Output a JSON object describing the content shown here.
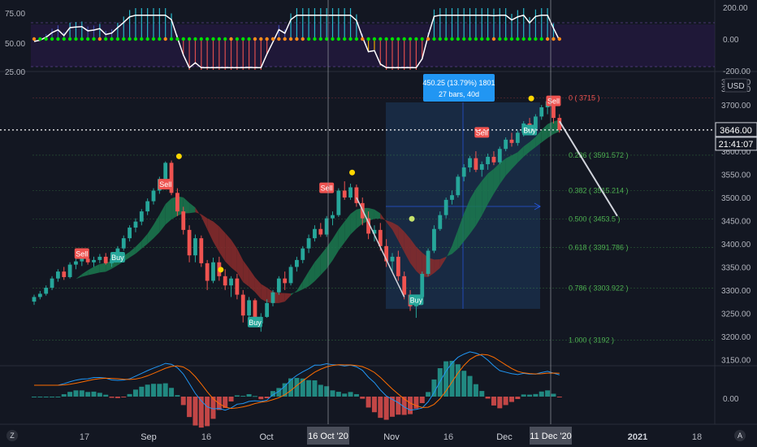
{
  "chart_data": [
    {
      "type": "line",
      "panel": "oscillator",
      "left_axis_ticks": [
        "75.00",
        "50.00",
        "25.00"
      ],
      "right_axis_ticks": [
        "200.00",
        "0.00",
        "-200.00"
      ],
      "colors": {
        "line": "#ffffff",
        "dots_green": "#00e000",
        "dots_orange": "#ff8c1a",
        "hist_up": "#26c6da",
        "hist_down": "#ef5350",
        "hist_neutral": "#3f51b5",
        "band": "#2a1a4a"
      }
    },
    {
      "type": "candlestick",
      "panel": "price",
      "symbol_currency": "USD",
      "price_label": "3646.00",
      "countdown": "21:41:07",
      "y_ticks": [
        "3750.00",
        "3700.00",
        "3650.00",
        "3600.00",
        "3550.00",
        "3500.00",
        "3450.00",
        "3400.00",
        "3350.00",
        "3300.00",
        "3250.00",
        "3200.00",
        "3150.00"
      ],
      "ylim": [
        3140,
        3760
      ],
      "x_ticks": [
        "17",
        "Sep",
        "16",
        "Oct",
        "Nov",
        "16",
        "Dec",
        "2021",
        "18"
      ],
      "crosshair_labels": [
        "16 Oct '20",
        "11 Dec '20"
      ],
      "fib_levels": [
        {
          "label": "0 ( 3715 )",
          "price": 3715,
          "color": "#ef5350"
        },
        {
          "label": "0.236 ( 3591.572 )",
          "price": 3591.572,
          "color": "#4caf50"
        },
        {
          "label": "0.382 ( 3515.214 )",
          "price": 3515.214,
          "color": "#4caf50"
        },
        {
          "label": "0.500 ( 3453.5 )",
          "price": 3453.5,
          "color": "#4caf50"
        },
        {
          "label": "0.618 ( 3391.786 )",
          "price": 3391.786,
          "color": "#4caf50"
        },
        {
          "label": "0.786 ( 3303.922 )",
          "price": 3303.922,
          "color": "#4caf50"
        },
        {
          "label": "1.000 ( 3192 )",
          "price": 3192,
          "color": "#4caf50"
        }
      ],
      "measure_box": {
        "line1": "450.25 (13.79%) 1801",
        "line2": "27 bars, 40d"
      },
      "signals": [
        {
          "label": "Sell",
          "price": 3378
        },
        {
          "label": "Buy",
          "price": 3370
        },
        {
          "label": "Sell",
          "price": 3528
        },
        {
          "label": "Buy",
          "price": 3230
        },
        {
          "label": "Sell",
          "price": 3520
        },
        {
          "label": "Buy",
          "price": 3278
        },
        {
          "label": "Sell",
          "price": 3640
        },
        {
          "label": "Buy",
          "price": 3645
        },
        {
          "label": "Sell",
          "price": 3708
        }
      ],
      "candles": [
        [
          3275,
          3290,
          3268,
          3285
        ],
        [
          3285,
          3298,
          3280,
          3292
        ],
        [
          3292,
          3310,
          3288,
          3305
        ],
        [
          3305,
          3330,
          3300,
          3325
        ],
        [
          3325,
          3345,
          3318,
          3340
        ],
        [
          3340,
          3350,
          3322,
          3328
        ],
        [
          3328,
          3360,
          3325,
          3355
        ],
        [
          3355,
          3370,
          3345,
          3362
        ],
        [
          3362,
          3378,
          3352,
          3368
        ],
        [
          3368,
          3380,
          3355,
          3360
        ],
        [
          3360,
          3372,
          3350,
          3365
        ],
        [
          3365,
          3378,
          3358,
          3372
        ],
        [
          3372,
          3380,
          3355,
          3358
        ],
        [
          3358,
          3372,
          3350,
          3368
        ],
        [
          3368,
          3395,
          3365,
          3390
        ],
        [
          3390,
          3418,
          3385,
          3412
        ],
        [
          3412,
          3440,
          3405,
          3435
        ],
        [
          3435,
          3455,
          3425,
          3448
        ],
        [
          3448,
          3475,
          3440,
          3470
        ],
        [
          3470,
          3498,
          3462,
          3492
        ],
        [
          3492,
          3520,
          3485,
          3515
        ],
        [
          3515,
          3545,
          3508,
          3540
        ],
        [
          3540,
          3578,
          3530,
          3575
        ],
        [
          3575,
          3580,
          3505,
          3510
        ],
        [
          3510,
          3520,
          3460,
          3470
        ],
        [
          3470,
          3480,
          3420,
          3430
        ],
        [
          3430,
          3440,
          3360,
          3375
        ],
        [
          3375,
          3420,
          3360,
          3412
        ],
        [
          3412,
          3418,
          3350,
          3358
        ],
        [
          3358,
          3365,
          3300,
          3320
        ],
        [
          3320,
          3370,
          3315,
          3360
        ],
        [
          3360,
          3372,
          3320,
          3330
        ],
        [
          3330,
          3345,
          3300,
          3310
        ],
        [
          3310,
          3330,
          3285,
          3325
        ],
        [
          3325,
          3335,
          3280,
          3290
        ],
        [
          3290,
          3300,
          3230,
          3245
        ],
        [
          3245,
          3285,
          3235,
          3278
        ],
        [
          3278,
          3282,
          3220,
          3228
        ],
        [
          3228,
          3250,
          3210,
          3242
        ],
        [
          3242,
          3280,
          3240,
          3272
        ],
        [
          3272,
          3300,
          3265,
          3295
        ],
        [
          3295,
          3330,
          3290,
          3325
        ],
        [
          3325,
          3340,
          3300,
          3315
        ],
        [
          3315,
          3355,
          3310,
          3350
        ],
        [
          3350,
          3372,
          3340,
          3365
        ],
        [
          3365,
          3395,
          3358,
          3390
        ],
        [
          3390,
          3420,
          3380,
          3412
        ],
        [
          3412,
          3440,
          3405,
          3432
        ],
        [
          3432,
          3445,
          3415,
          3420
        ],
        [
          3420,
          3460,
          3415,
          3455
        ],
        [
          3455,
          3470,
          3440,
          3462
        ],
        [
          3462,
          3520,
          3458,
          3515
        ],
        [
          3515,
          3535,
          3495,
          3500
        ],
        [
          3500,
          3530,
          3495,
          3522
        ],
        [
          3522,
          3528,
          3480,
          3488
        ],
        [
          3488,
          3500,
          3440,
          3455
        ],
        [
          3455,
          3470,
          3410,
          3422
        ],
        [
          3422,
          3440,
          3405,
          3430
        ],
        [
          3430,
          3445,
          3385,
          3395
        ],
        [
          3395,
          3410,
          3350,
          3362
        ],
        [
          3362,
          3380,
          3340,
          3372
        ],
        [
          3372,
          3385,
          3320,
          3330
        ],
        [
          3330,
          3340,
          3280,
          3290
        ],
        [
          3290,
          3300,
          3255,
          3265
        ],
        [
          3265,
          3290,
          3240,
          3285
        ],
        [
          3285,
          3340,
          3282,
          3335
        ],
        [
          3335,
          3390,
          3330,
          3385
        ],
        [
          3385,
          3440,
          3380,
          3432
        ],
        [
          3432,
          3470,
          3428,
          3462
        ],
        [
          3462,
          3500,
          3455,
          3495
        ],
        [
          3495,
          3515,
          3485,
          3505
        ],
        [
          3505,
          3550,
          3500,
          3545
        ],
        [
          3545,
          3572,
          3535,
          3565
        ],
        [
          3565,
          3590,
          3555,
          3585
        ],
        [
          3585,
          3600,
          3555,
          3560
        ],
        [
          3560,
          3578,
          3545,
          3572
        ],
        [
          3572,
          3595,
          3560,
          3588
        ],
        [
          3588,
          3600,
          3570,
          3576
        ],
        [
          3576,
          3610,
          3572,
          3605
        ],
        [
          3605,
          3630,
          3600,
          3625
        ],
        [
          3625,
          3640,
          3610,
          3618
        ],
        [
          3618,
          3645,
          3612,
          3640
        ],
        [
          3640,
          3665,
          3632,
          3660
        ],
        [
          3660,
          3672,
          3640,
          3648
        ],
        [
          3648,
          3680,
          3645,
          3675
        ],
        [
          3675,
          3700,
          3668,
          3695
        ],
        [
          3695,
          3715,
          3680,
          3708
        ],
        [
          3708,
          3712,
          3660,
          3672
        ],
        [
          3672,
          3680,
          3640,
          3646
        ]
      ]
    },
    {
      "type": "line",
      "panel": "macd",
      "y_ticks": [
        "0.00"
      ],
      "colors": {
        "macd": "#2196f3",
        "signal": "#ff6d00",
        "hist_pos": "#26a69a",
        "hist_neg": "#ef5350"
      }
    }
  ],
  "bottom": {
    "left_icon": "Z",
    "right_icon": "A"
  }
}
